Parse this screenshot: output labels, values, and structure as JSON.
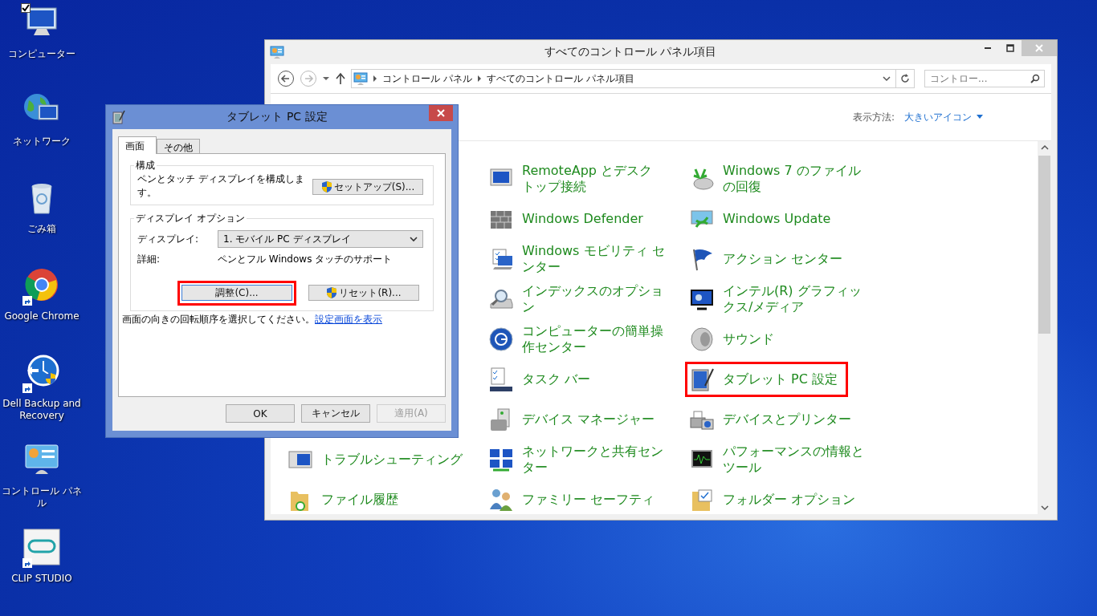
{
  "desktop_icons": [
    {
      "label": "コンピューター",
      "checked": true,
      "shortcut": false
    },
    {
      "label": "ネットワーク",
      "checked": false,
      "shortcut": false
    },
    {
      "label": "ごみ箱",
      "checked": false,
      "shortcut": false
    },
    {
      "label": "Google Chrome",
      "checked": false,
      "shortcut": true
    },
    {
      "label": "Dell Backup and Recovery",
      "checked": false,
      "shortcut": true
    },
    {
      "label": "コントロール パネル",
      "checked": false,
      "shortcut": false
    },
    {
      "label": "CLIP STUDIO",
      "checked": false,
      "shortcut": true
    }
  ],
  "control_panel": {
    "title": "すべてのコントロール パネル項目",
    "breadcrumbs": [
      "コントロール パネル",
      "すべてのコントロール パネル項目"
    ],
    "search": {
      "placeholder": "コントロー..."
    },
    "view_label": "表示方法:",
    "view_mode": "大きいアイコン",
    "rows": [
      {
        "column_2": {
          "label": "RemoteApp とデスクトップ接続",
          "highlighted": false
        },
        "column_3": {
          "label": "Windows 7 のファイルの回復",
          "highlighted": false
        }
      },
      {
        "column_2": {
          "label": "Windows Defender",
          "highlighted": false
        },
        "column_3": {
          "label": "Windows Update",
          "highlighted": false
        }
      },
      {
        "column_2": {
          "label": "Windows モビリティ センター",
          "highlighted": false
        },
        "column_3": {
          "label": "アクション センター",
          "highlighted": false
        }
      },
      {
        "column_2": {
          "label": "インデックスのオプション",
          "highlighted": false
        },
        "column_3": {
          "label": "インテル(R) グラフィックス/メディア",
          "highlighted": false
        }
      },
      {
        "column_2": {
          "label": "コンピューターの簡単操作センター",
          "highlighted": false
        },
        "column_3": {
          "label": "サウンド",
          "highlighted": false
        }
      },
      {
        "column_2": {
          "label": "タスク バー",
          "highlighted": false
        },
        "column_3": {
          "label": "タブレット PC 設定",
          "highlighted": true
        }
      },
      {
        "column_2": {
          "label": "デバイス マネージャー",
          "highlighted": false
        },
        "column_3": {
          "label": "デバイスとプリンター",
          "highlighted": false
        }
      },
      {
        "column_1": {
          "label": "トラブルシューティング",
          "highlighted": false
        },
        "column_2": {
          "label": "ネットワークと共有センター",
          "highlighted": false
        },
        "column_3": {
          "label": "パフォーマンスの情報とツール",
          "highlighted": false
        }
      },
      {
        "column_1": {
          "label": "ファイル履歴",
          "highlighted": false
        },
        "column_2": {
          "label": "ファミリー セーフティ",
          "highlighted": false
        },
        "column_3": {
          "label": "フォルダー オプション",
          "highlighted": false
        }
      }
    ]
  },
  "dialog": {
    "title": "タブレット PC 設定",
    "tabs": [
      {
        "label": "画面",
        "selected": true
      },
      {
        "label": "その他",
        "selected": false
      }
    ],
    "configure": {
      "title": "構成",
      "text": "ペンとタッチ ディスプレイを構成します。",
      "button": "セットアップ(S)..."
    },
    "display_options": {
      "title": "ディスプレイ オプション",
      "display_label": "ディスプレイ:",
      "display_value": "1. モバイル PC ディスプレイ",
      "detail_label": "詳細:",
      "detail_value": "ペンとフル Windows タッチのサポート",
      "buttons": [
        {
          "label": "調整(C)...",
          "shield": false,
          "highlighted": true
        },
        {
          "label": "リセット(R)...",
          "shield": true,
          "highlighted": false
        }
      ]
    },
    "instruction": "画面の向きの回転順序を選択してください。",
    "link": "設定画面を表示",
    "footer_buttons": [
      {
        "label": "OK",
        "disabled": false
      },
      {
        "label": "キャンセル",
        "disabled": false
      },
      {
        "label": "適用(A)",
        "disabled": true
      }
    ]
  }
}
